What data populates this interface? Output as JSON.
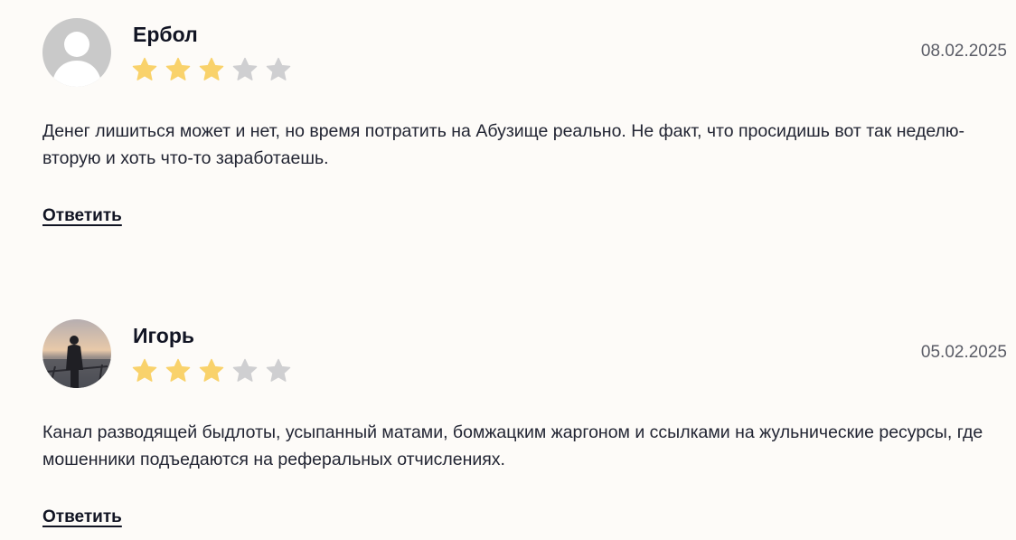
{
  "reviews": [
    {
      "author": "Ербол",
      "avatar": "default-avatar-icon",
      "rating": 3,
      "max_rating": 5,
      "date": "08.02.2025",
      "text": "Денег лишиться может и нет, но время потратить на Абузище реально. Не факт, что просидишь вот так неделю-вторую и хоть что-то заработаешь.",
      "reply_label": "Ответить"
    },
    {
      "author": "Игорь",
      "avatar": "user-photo-avatar",
      "rating": 3,
      "max_rating": 5,
      "date": "05.02.2025",
      "text": "Канал разводящей быдлоты, усыпанный матами, бомжацким жаргоном и ссылками на жульнические ресурсы, где мошенники подъедаются на реферальных отчислениях.",
      "reply_label": "Ответить"
    }
  ],
  "colors": {
    "background": "#fdfbf8",
    "star_filled": "#f9d26b",
    "star_empty": "#cfcfd1",
    "text": "#222533"
  }
}
